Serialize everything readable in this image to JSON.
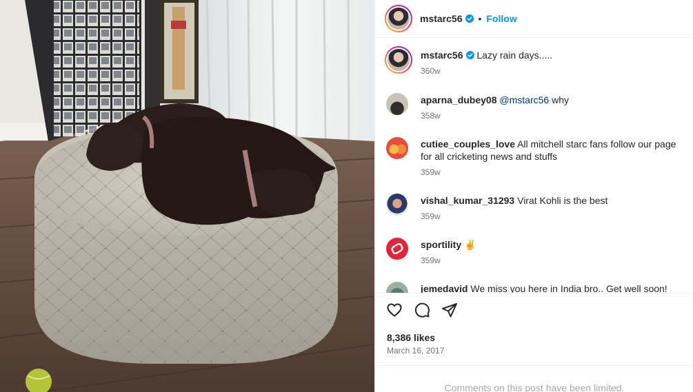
{
  "post": {
    "username": "mstarc56",
    "follow_label": "Follow",
    "separator": "•",
    "caption": "Lazy rain days.....",
    "caption_time": "360w",
    "likes": "8,386 likes",
    "date": "March 16, 2017",
    "limited_notice": "Comments on this post have been limited."
  },
  "comments": [
    {
      "user": "aparna_dubey08",
      "mention": "@mstarc56",
      "text": " why",
      "time": "358w"
    },
    {
      "user": "cutiee_couples_love",
      "mention": "",
      "text": " All mitchell starc fans follow our page for all cricketing news and stuffs",
      "time": "359w"
    },
    {
      "user": "vishal_kumar_31293",
      "mention": "",
      "text": " Virat Kohli is the best",
      "time": "359w"
    },
    {
      "user": "sportility",
      "mention": "",
      "text": " ✌",
      "time": "359w"
    },
    {
      "user": "jemedavid",
      "mention": "",
      "text": " We miss you here in India bro.. Get well soon!",
      "time": ""
    }
  ],
  "icons": {
    "like": "heart-icon",
    "comment": "comment-icon",
    "share": "share-icon",
    "verified": "verified-badge-icon"
  },
  "colors": {
    "accent": "#0095f6",
    "mention": "#00376b",
    "muted": "#737373"
  }
}
